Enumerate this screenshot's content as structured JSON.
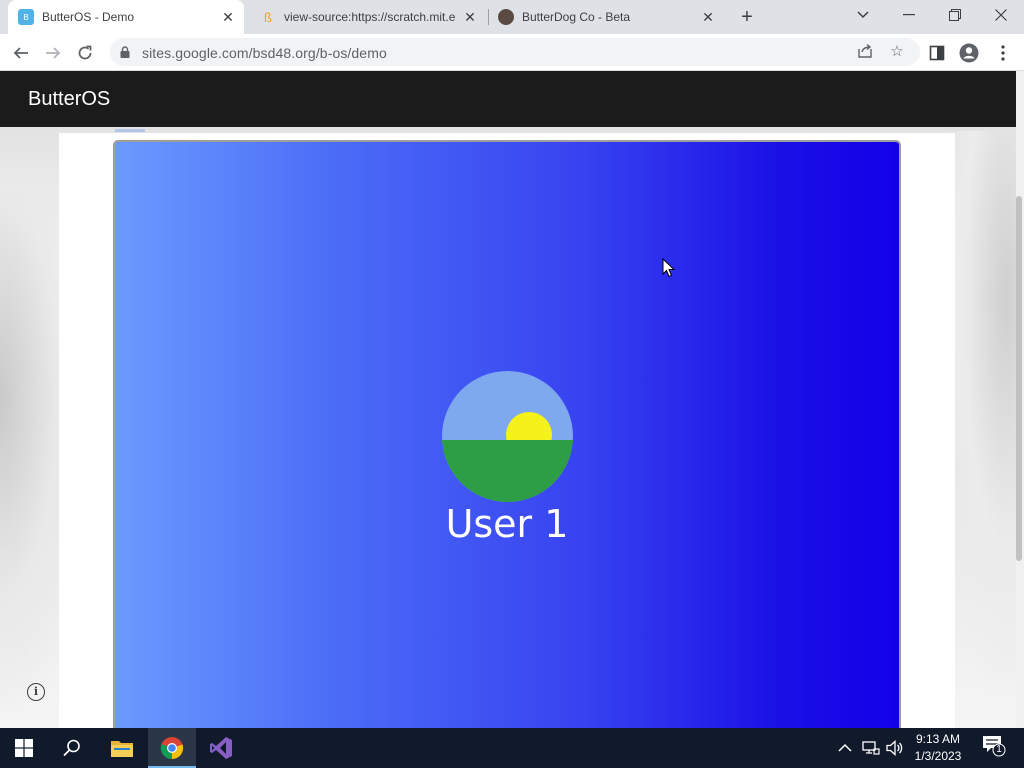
{
  "browser": {
    "tabs": [
      {
        "title": "ButterOS - Demo",
        "active": true
      },
      {
        "title": "view-source:https://scratch.mit.e",
        "active": false
      },
      {
        "title": "ButterDog Co - Beta",
        "active": false
      }
    ],
    "favicon_label": "B",
    "url": "sites.google.com/bsd48.org/b-os/demo"
  },
  "site": {
    "title": "ButterOS"
  },
  "stage": {
    "username": "User 1",
    "colors": {
      "gradient_start": "#6b9bff",
      "gradient_end": "#1300e8",
      "sky": "#7fa9ef",
      "sun": "#f4f21a",
      "ground": "#2e9e46"
    }
  },
  "taskbar": {
    "time": "9:13 AM",
    "date": "1/3/2023",
    "notification_count": "1",
    "icons": [
      "windows-start-icon",
      "search-icon",
      "file-explorer-icon",
      "chrome-icon",
      "visual-studio-icon"
    ]
  }
}
